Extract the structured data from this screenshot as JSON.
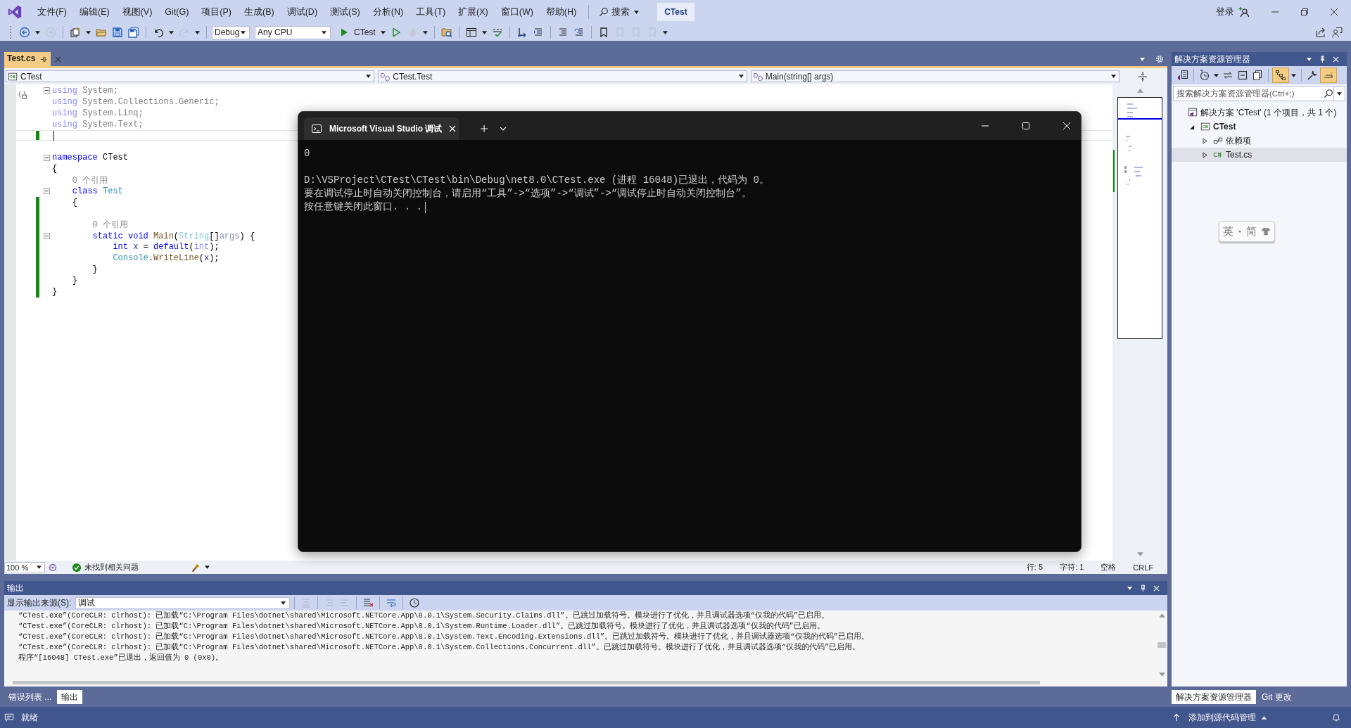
{
  "window": {
    "menu": [
      "文件(F)",
      "编辑(E)",
      "视图(V)",
      "Git(G)",
      "项目(P)",
      "生成(B)",
      "调试(D)",
      "测试(S)",
      "分析(N)",
      "工具(T)",
      "扩展(X)",
      "窗口(W)",
      "帮助(H)"
    ],
    "search": "搜索",
    "solution_name": "CTest",
    "sign_in": "登录"
  },
  "toolbar": [
    {
      "kind": "back",
      "disabled": false
    },
    {
      "kind": "dropdown_arrow"
    },
    {
      "kind": "forward",
      "disabled": true
    },
    {
      "kind": "sep"
    },
    {
      "kind": "new_item",
      "disabled": false
    },
    {
      "kind": "dropdown_arrow"
    },
    {
      "kind": "open",
      "disabled": false
    },
    {
      "kind": "save",
      "disabled": false
    },
    {
      "kind": "save_all",
      "disabled": false
    },
    {
      "kind": "sep"
    },
    {
      "kind": "undo",
      "disabled": false
    },
    {
      "kind": "dropdown_arrow"
    },
    {
      "kind": "redo",
      "disabled": true
    },
    {
      "kind": "dropdown_arrow"
    },
    {
      "kind": "sep"
    },
    {
      "kind": "configuration",
      "value": "Debug"
    },
    {
      "kind": "platform",
      "value": "Any CPU"
    },
    {
      "kind": "start",
      "label": "CTest"
    },
    {
      "kind": "dropdown_arrow"
    },
    {
      "kind": "start_no_debug",
      "disabled": false
    },
    {
      "kind": "hot_reload",
      "disabled": true
    },
    {
      "kind": "dropdown_arrow"
    },
    {
      "kind": "sep"
    },
    {
      "kind": "find_files",
      "disabled": false
    },
    {
      "kind": "sep"
    },
    {
      "kind": "layout",
      "disabled": false
    },
    {
      "kind": "dropdown_arrow"
    },
    {
      "kind": "spell",
      "disabled": false
    },
    {
      "kind": "sep"
    },
    {
      "kind": "step",
      "disabled": false
    },
    {
      "kind": "format",
      "disabled": false
    },
    {
      "kind": "sep"
    },
    {
      "kind": "comment",
      "disabled": false
    },
    {
      "kind": "uncomment",
      "disabled": false
    },
    {
      "kind": "sep"
    },
    {
      "kind": "bookmark",
      "disabled": false
    },
    {
      "kind": "bookmark",
      "disabled": true
    },
    {
      "kind": "bookmark",
      "disabled": true
    },
    {
      "kind": "bookmark",
      "disabled": true
    },
    {
      "kind": "dropdown_arrow"
    }
  ],
  "editor": {
    "tab": {
      "title": "Test.cs",
      "selected": true
    },
    "nav": [
      "CTest",
      "CTest.Test",
      "Main(string[] args)"
    ],
    "lines": [
      {
        "kind": "code",
        "fold": true,
        "changed": false,
        "tokens": [
          {
            "text": "using",
            "kind": "faded_kw"
          },
          {
            "text": " System;",
            "kind": "faded"
          }
        ]
      },
      {
        "kind": "code",
        "changed": false,
        "tokens": [
          {
            "text": "using",
            "kind": "faded_kw"
          },
          {
            "text": " System.Collections.Generic;",
            "kind": "faded"
          }
        ]
      },
      {
        "kind": "code",
        "changed": false,
        "tokens": [
          {
            "text": "using",
            "kind": "faded_kw"
          },
          {
            "text": " System.Linq;",
            "kind": "faded"
          }
        ]
      },
      {
        "kind": "code",
        "changed": false,
        "tokens": [
          {
            "text": "using",
            "kind": "faded_kw"
          },
          {
            "text": " System.Text;",
            "kind": "faded"
          }
        ]
      },
      {
        "kind": "blank",
        "changed": true,
        "caret": true
      },
      {
        "kind": "blank",
        "changed": false
      },
      {
        "kind": "code",
        "fold": true,
        "changed": false,
        "tokens": [
          {
            "text": "namespace",
            "kind": "kw"
          },
          {
            "text": " CTest",
            "kind": "plain"
          }
        ]
      },
      {
        "kind": "code",
        "changed": false,
        "tokens": [
          {
            "text": "{",
            "kind": "plain"
          }
        ]
      },
      {
        "kind": "codelens",
        "changed": false,
        "text": "    0 个引用"
      },
      {
        "kind": "code",
        "fold": true,
        "changed": false,
        "tokens": [
          {
            "text": "    class ",
            "kind": "kw"
          },
          {
            "text": "Test",
            "kind": "type"
          }
        ]
      },
      {
        "kind": "code",
        "changed": true,
        "tokens": [
          {
            "text": "    {",
            "kind": "plain"
          }
        ]
      },
      {
        "kind": "blank",
        "changed": true
      },
      {
        "kind": "codelens",
        "changed": true,
        "text": "        0 个引用"
      },
      {
        "kind": "code",
        "fold": true,
        "changed": true,
        "tokens": [
          {
            "text": "        static void ",
            "kind": "kw"
          },
          {
            "text": "Main",
            "kind": "method"
          },
          {
            "text": "(",
            "kind": "plain"
          },
          {
            "text": "String",
            "kind": "type_faded"
          },
          {
            "text": "[]",
            "kind": "plain"
          },
          {
            "text": "args",
            "kind": "param"
          },
          {
            "text": ") {",
            "kind": "plain"
          }
        ]
      },
      {
        "kind": "code",
        "changed": true,
        "tokens": [
          {
            "text": "            int ",
            "kind": "kw"
          },
          {
            "text": "x",
            "kind": "local"
          },
          {
            "text": " = ",
            "kind": "plain"
          },
          {
            "text": "default",
            "kind": "kw"
          },
          {
            "text": "(",
            "kind": "plain"
          },
          {
            "text": "int",
            "kind": "kw_faded"
          },
          {
            "text": ");",
            "kind": "plain"
          }
        ]
      },
      {
        "kind": "code",
        "changed": true,
        "tokens": [
          {
            "text": "            Console",
            "kind": "type"
          },
          {
            "text": ".",
            "kind": "plain"
          },
          {
            "text": "WriteLine",
            "kind": "method"
          },
          {
            "text": "(",
            "kind": "plain"
          },
          {
            "text": "x",
            "kind": "local"
          },
          {
            "text": ");",
            "kind": "plain"
          }
        ]
      },
      {
        "kind": "code",
        "changed": true,
        "tokens": [
          {
            "text": "        }",
            "kind": "plain"
          }
        ]
      },
      {
        "kind": "code",
        "changed": true,
        "tokens": [
          {
            "text": "    }",
            "kind": "plain"
          }
        ]
      },
      {
        "kind": "code",
        "changed": true,
        "tokens": [
          {
            "text": "}",
            "kind": "plain"
          }
        ]
      }
    ],
    "status": {
      "zoom": "100 %",
      "issues": "未找到相关问题",
      "line": "行: 5",
      "column": "字符: 1",
      "indent": "空格",
      "line_ending": "CRLF"
    }
  },
  "console": {
    "tab_title": "Microsoft Visual Studio 调试",
    "program_output": "0",
    "exit_lines": [
      "D:\\VSProject\\CTest\\CTest\\bin\\Debug\\net8.0\\CTest.exe (进程 16048)已退出，代码为 0。",
      "要在调试停止时自动关闭控制台，请启用“工具”->“选项”->“调试”->“调试停止时自动关闭控制台”。",
      "按任意键关闭此窗口. . ."
    ]
  },
  "output": {
    "title": "输出",
    "source_label": "显示输出来源(S):",
    "source": "调试",
    "lines": [
      "“CTest.exe”(CoreCLR: clrhost): 已加载“C:\\Program Files\\dotnet\\shared\\Microsoft.NETCore.App\\8.0.1\\System.Security.Claims.dll”。已跳过加载符号。模块进行了优化，并且调试器选项“仅我的代码”已启用。",
      "“CTest.exe”(CoreCLR: clrhost): 已加载“C:\\Program Files\\dotnet\\shared\\Microsoft.NETCore.App\\8.0.1\\System.Runtime.Loader.dll”。已跳过加载符号。模块进行了优化，并且调试器选项“仅我的代码”已启用。",
      "“CTest.exe”(CoreCLR: clrhost): 已加载“C:\\Program Files\\dotnet\\shared\\Microsoft.NETCore.App\\8.0.1\\System.Text.Encoding.Extensions.dll”。已跳过加载符号。模块进行了优化，并且调试器选项“仅我的代码”已启用。",
      "“CTest.exe”(CoreCLR: clrhost): 已加载“C:\\Program Files\\dotnet\\shared\\Microsoft.NETCore.App\\8.0.1\\System.Collections.Concurrent.dll”。已跳过加载符号。模块进行了优化，并且调试器选项“仅我的代码”已启用。",
      "程序“[16048] CTest.exe”已退出，返回值为 0 (0x0)。"
    ],
    "tabs": [
      {
        "label": "错误列表 ...",
        "selected": false
      },
      {
        "label": "输出",
        "selected": true
      }
    ]
  },
  "solution_explorer": {
    "title": "解决方案资源管理器",
    "search_placeholder": "搜索解决方案资源管理器(Ctrl+;)",
    "tree": [
      {
        "kind": "solution",
        "label": "解决方案 'CTest' (1 个项目，共 1 个)",
        "selected": false,
        "children": [
          {
            "kind": "project",
            "label": "CTest",
            "expanded": true,
            "selected": false,
            "children": [
              {
                "kind": "dependencies",
                "label": "依赖项",
                "expanded": false,
                "selected": false
              },
              {
                "kind": "file",
                "label": "Test.cs",
                "expanded": false,
                "selected": true
              }
            ]
          }
        ]
      }
    ],
    "tabs": [
      {
        "label": "解决方案资源管理器",
        "selected": true
      },
      {
        "label": "Git 更改",
        "selected": false
      }
    ]
  },
  "ime_bar": {
    "language": "英",
    "script": "简"
  },
  "status_bar": {
    "message": "就绪",
    "source_control": "添加到源代码管理"
  }
}
